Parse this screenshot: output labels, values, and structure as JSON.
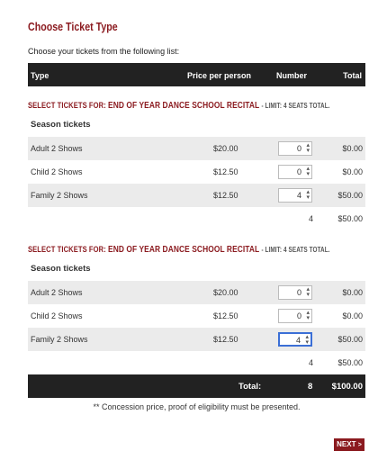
{
  "page": {
    "title": "Choose Ticket Type",
    "intro": "Choose your tickets from the following list:"
  },
  "table_header": {
    "type": "Type",
    "price": "Price per person",
    "number": "Number",
    "total": "Total"
  },
  "sections": [
    {
      "prefix": "SELECT TICKETS FOR:",
      "event": "END OF YEAR DANCE SCHOOL RECITAL",
      "limit": "- LIMIT: 4 SEATS TOTAL.",
      "group": "Season tickets",
      "rows": [
        {
          "name": "Adult 2 Shows",
          "price": "$20.00",
          "qty": "0",
          "total": "$0.00"
        },
        {
          "name": "Child 2 Shows",
          "price": "$12.50",
          "qty": "0",
          "total": "$0.00"
        },
        {
          "name": "Family 2 Shows",
          "price": "$12.50",
          "qty": "4",
          "total": "$50.00"
        }
      ],
      "subtotal_count": "4",
      "subtotal_amount": "$50.00"
    },
    {
      "prefix": "SELECT TICKETS FOR:",
      "event": "END OF YEAR DANCE SCHOOL RECITAL",
      "limit": "- LIMIT: 4 SEATS TOTAL.",
      "group": "Season tickets",
      "rows": [
        {
          "name": "Adult 2 Shows",
          "price": "$20.00",
          "qty": "0",
          "total": "$0.00"
        },
        {
          "name": "Child 2 Shows",
          "price": "$12.50",
          "qty": "0",
          "total": "$0.00"
        },
        {
          "name": "Family 2 Shows",
          "price": "$12.50",
          "qty": "4",
          "total": "$50.00"
        }
      ],
      "subtotal_count": "4",
      "subtotal_amount": "$50.00"
    }
  ],
  "grand_total": {
    "label": "Total:",
    "count": "8",
    "amount": "$100.00"
  },
  "note": "** Concession price, proof of eligibility must be presented.",
  "next_button": {
    "label": "NEXT",
    "arrow": ">"
  },
  "colors": {
    "accent": "#8b1a1f",
    "header_bg": "#222222",
    "row_shade": "#ebebeb",
    "focus": "#3b6fd6"
  }
}
